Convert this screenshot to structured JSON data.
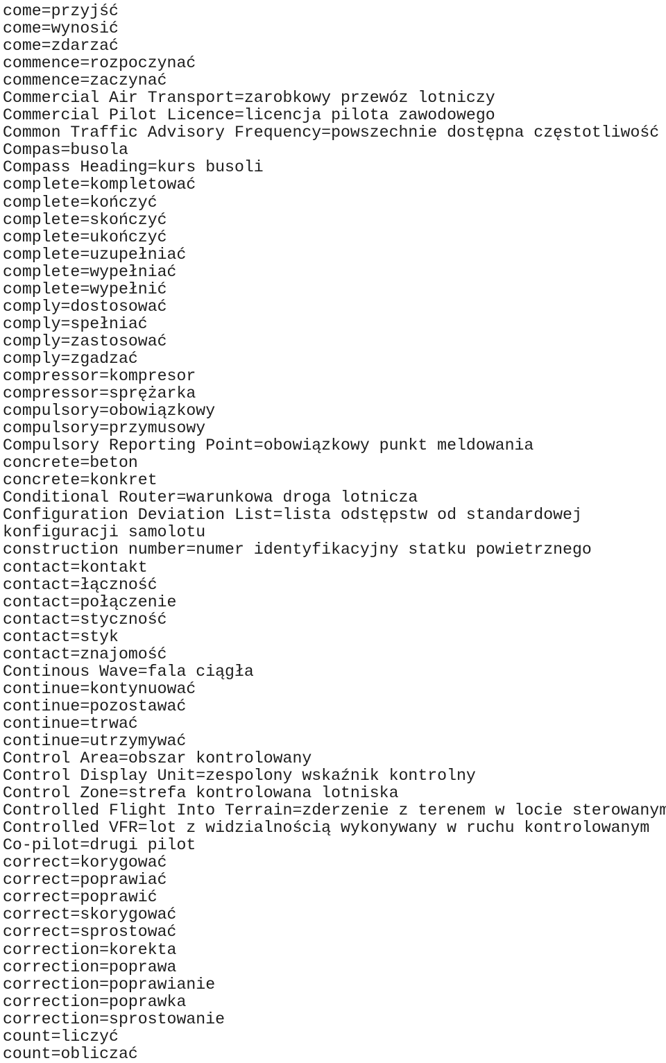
{
  "page": {
    "kind": "glossary-page",
    "language_pair": "English=Polish",
    "text_color": "#1d1d1d",
    "background_color": "#ffffff"
  },
  "entries": [
    {
      "text": "come=przyjść"
    },
    {
      "text": "come=wynosić"
    },
    {
      "text": "come=zdarzać"
    },
    {
      "text": "commence=rozpoczynać"
    },
    {
      "text": "commence=zaczynać"
    },
    {
      "text": "Commercial Air Transport=zarobkowy przewóz lotniczy"
    },
    {
      "text": "Commercial Pilot Licence=licencja pilota zawodowego"
    },
    {
      "text": "Common Traffic Advisory Frequency=powszechnie dostępna częstotliwość"
    },
    {
      "text": "Compas=busola"
    },
    {
      "text": "Compass Heading=kurs busoli"
    },
    {
      "text": "complete=kompletować"
    },
    {
      "text": "complete=kończyć"
    },
    {
      "text": "complete=skończyć"
    },
    {
      "text": "complete=ukończyć"
    },
    {
      "text": "complete=uzupełniać"
    },
    {
      "text": "complete=wypełniać"
    },
    {
      "text": "complete=wypełnić"
    },
    {
      "text": "comply=dostosować"
    },
    {
      "text": "comply=spełniać"
    },
    {
      "text": "comply=zastosować"
    },
    {
      "text": "comply=zgadzać"
    },
    {
      "text": "compressor=kompresor"
    },
    {
      "text": "compressor=sprężarka"
    },
    {
      "text": "compulsory=obowiązkowy"
    },
    {
      "text": "compulsory=przymusowy"
    },
    {
      "text": "Compulsory Reporting Point=obowiązkowy punkt meldowania"
    },
    {
      "text": "concrete=beton"
    },
    {
      "text": "concrete=konkret"
    },
    {
      "text": "Conditional Router=warunkowa droga lotnicza"
    },
    {
      "text": "Configuration Deviation List=lista odstępstw od standardowej konfiguracji samolotu",
      "wraps": true
    },
    {
      "text": "construction number=numer identyfikacyjny statku powietrznego"
    },
    {
      "text": "contact=kontakt"
    },
    {
      "text": "contact=łączność"
    },
    {
      "text": "contact=połączenie"
    },
    {
      "text": "contact=styczność"
    },
    {
      "text": "contact=styk"
    },
    {
      "text": "contact=znajomość"
    },
    {
      "text": "Continous Wave=fala ciągła"
    },
    {
      "text": "continue=kontynuować"
    },
    {
      "text": "continue=pozostawać"
    },
    {
      "text": "continue=trwać"
    },
    {
      "text": "continue=utrzymywać"
    },
    {
      "text": "Control Area=obszar kontrolowany"
    },
    {
      "text": "Control Display Unit=zespolony wskaźnik kontrolny"
    },
    {
      "text": "Control Zone=strefa kontrolowana lotniska"
    },
    {
      "text": "Controlled Flight Into Terrain=zderzenie z terenem w locie sterowanym"
    },
    {
      "text": "Controlled VFR=lot z widzialnością wykonywany w ruchu kontrolowanym"
    },
    {
      "text": "Co-pilot=drugi pilot"
    },
    {
      "text": "correct=korygować"
    },
    {
      "text": "correct=poprawiać"
    },
    {
      "text": "correct=poprawić"
    },
    {
      "text": "correct=skorygować"
    },
    {
      "text": "correct=sprostować"
    },
    {
      "text": "correction=korekta"
    },
    {
      "text": "correction=poprawa"
    },
    {
      "text": "correction=poprawianie"
    },
    {
      "text": "correction=poprawka"
    },
    {
      "text": "correction=sprostowanie"
    },
    {
      "text": "count=liczyć"
    },
    {
      "text": "count=obliczać"
    }
  ]
}
